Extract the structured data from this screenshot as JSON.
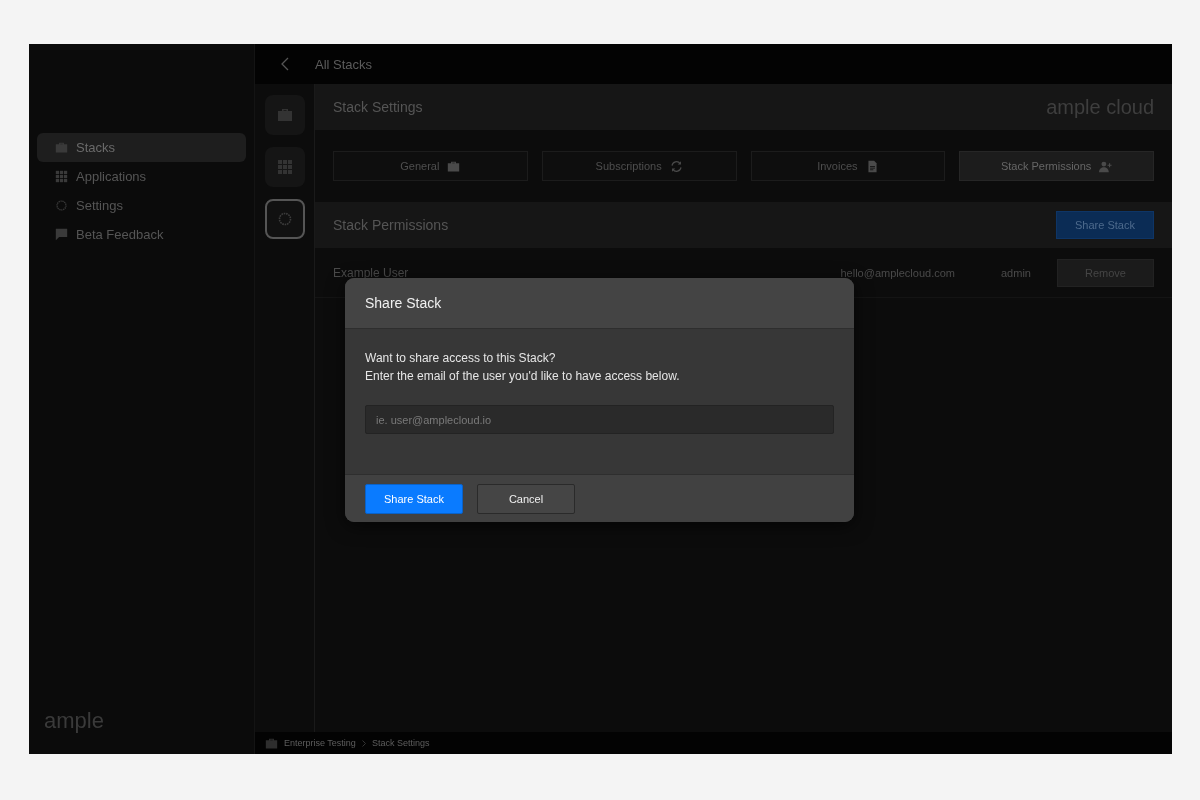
{
  "topbar": {
    "title": "All Stacks"
  },
  "sidebar": {
    "items": [
      {
        "label": "Stacks",
        "selected": true
      },
      {
        "label": "Applications",
        "selected": false
      },
      {
        "label": "Settings",
        "selected": false
      },
      {
        "label": "Beta Feedback",
        "selected": false
      }
    ],
    "logo": "ample"
  },
  "rail": [
    {
      "selected": false
    },
    {
      "selected": false
    },
    {
      "selected": true
    }
  ],
  "header": {
    "title": "Stack Settings",
    "logo": "ample cloud"
  },
  "tabs": [
    {
      "label": "General",
      "selected": false
    },
    {
      "label": "Subscriptions",
      "selected": false
    },
    {
      "label": "Invoices",
      "selected": false
    },
    {
      "label": "Stack Permissions",
      "selected": true
    }
  ],
  "permissions": {
    "title": "Stack Permissions",
    "share_button": "Share Stack",
    "rows": [
      {
        "name": "Example User",
        "email": "hello@amplecloud.com",
        "role": "admin",
        "action": "Remove"
      }
    ]
  },
  "breadcrumb": [
    "Enterprise Testing",
    "Stack Settings"
  ],
  "dialog": {
    "title": "Share Stack",
    "lines": [
      "Want to share access to this Stack?",
      "Enter the email of the user you'd like to have access below."
    ],
    "email": {
      "placeholder": "ie. user@amplecloud.io"
    },
    "buttons": [
      {
        "label": "Share Stack",
        "kind": "primary"
      },
      {
        "label": "Cancel",
        "kind": "secondary"
      }
    ]
  }
}
